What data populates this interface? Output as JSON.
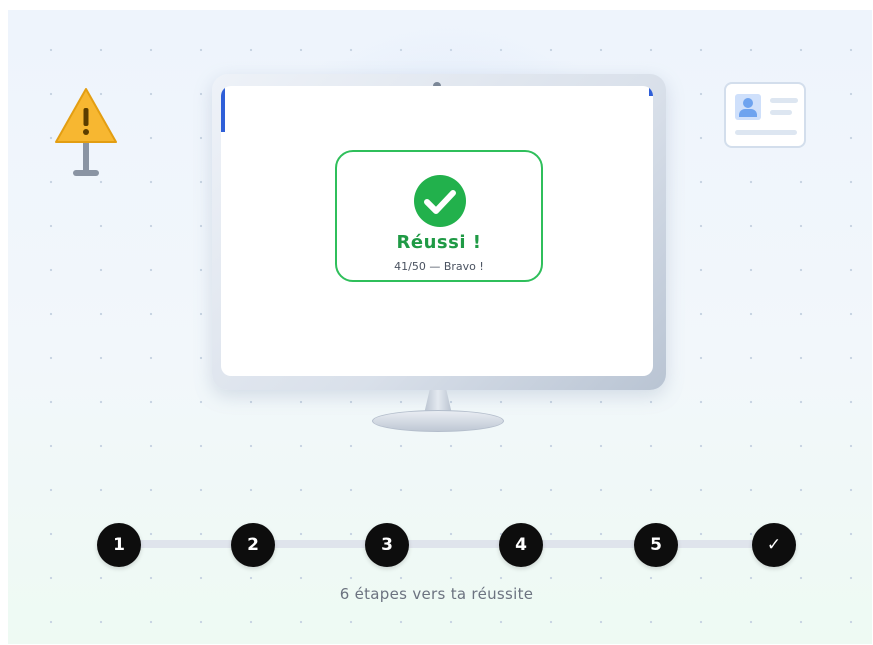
{
  "result_card": {
    "title": "Réussi !",
    "subtitle": "41/50 — Bravo !",
    "accent_color": "#2fbf5b",
    "icon": "check-circle-icon"
  },
  "steps": [
    {
      "label": "1"
    },
    {
      "label": "2"
    },
    {
      "label": "3"
    },
    {
      "label": "4"
    },
    {
      "label": "5"
    },
    {
      "label": "✓"
    }
  ],
  "caption": "6 étapes vers ta réussite",
  "decorations": {
    "left": "warning-sign-icon",
    "right": "id-card-icon"
  }
}
